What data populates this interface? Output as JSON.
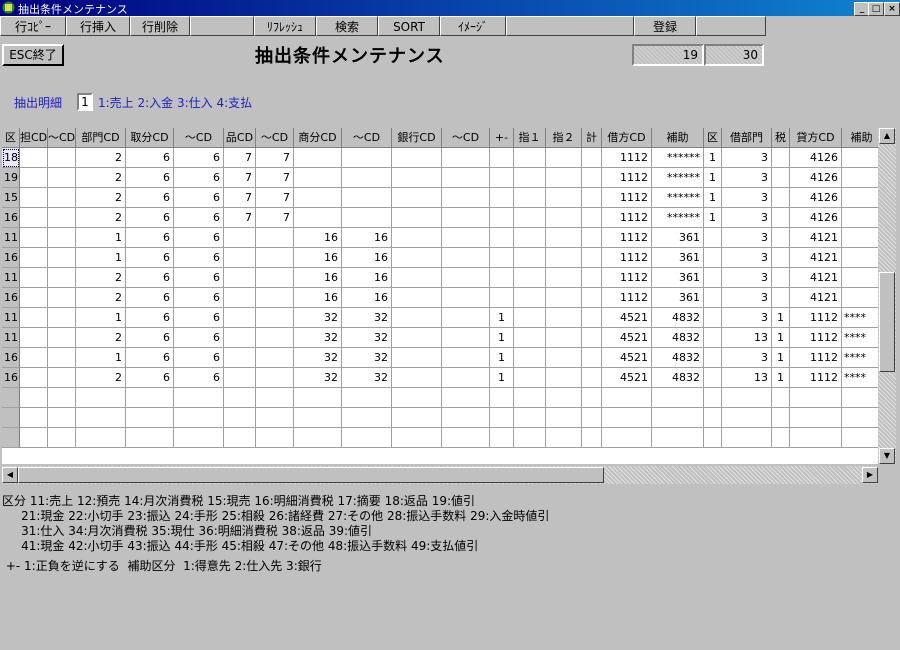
{
  "window": {
    "title": "抽出条件メンテナンス",
    "min": "_",
    "max": "□",
    "close": "×"
  },
  "toolbar": {
    "buttons": [
      "行ｺﾋﾟｰ",
      "行挿入",
      "行削除",
      "",
      "ﾘﾌﾚｯｼｭ",
      "検索",
      "SORT",
      "ｲﾒｰｼﾞ",
      "",
      "登録",
      ""
    ]
  },
  "esc_label": "ESC終了",
  "page_title": "抽出条件メンテナンス",
  "pager": {
    "current": "19",
    "total": "30"
  },
  "filter": {
    "label": "抽出明細",
    "value": "1",
    "hint": "1:売上 2:入金 3:仕入 4:支払"
  },
  "table": {
    "headers": [
      "区",
      "担CD",
      "〜CD",
      "部門CD",
      "取分CD",
      "〜CD",
      "品CD",
      "〜CD",
      "商分CD",
      "〜CD",
      "銀行CD",
      "〜CD",
      "+-",
      "指１",
      "指２",
      "計",
      "借方CD",
      "補助",
      "区",
      "借部門",
      "税",
      "貸方CD",
      "補助"
    ],
    "rows": [
      [
        "18",
        "",
        "",
        "2",
        "6",
        "6",
        "7",
        "7",
        "",
        "",
        "",
        "",
        "",
        "",
        "",
        "",
        "1112",
        "******",
        "1",
        "3",
        "",
        "4126",
        ""
      ],
      [
        "19",
        "",
        "",
        "2",
        "6",
        "6",
        "7",
        "7",
        "",
        "",
        "",
        "",
        "",
        "",
        "",
        "",
        "1112",
        "******",
        "1",
        "3",
        "",
        "4126",
        ""
      ],
      [
        "15",
        "",
        "",
        "2",
        "6",
        "6",
        "7",
        "7",
        "",
        "",
        "",
        "",
        "",
        "",
        "",
        "",
        "1112",
        "******",
        "1",
        "3",
        "",
        "4126",
        ""
      ],
      [
        "16",
        "",
        "",
        "2",
        "6",
        "6",
        "7",
        "7",
        "",
        "",
        "",
        "",
        "",
        "",
        "",
        "",
        "1112",
        "******",
        "1",
        "3",
        "",
        "4126",
        ""
      ],
      [
        "11",
        "",
        "",
        "1",
        "6",
        "6",
        "",
        "",
        "16",
        "16",
        "",
        "",
        "",
        "",
        "",
        "",
        "1112",
        "361",
        "",
        "3",
        "",
        "4121",
        ""
      ],
      [
        "16",
        "",
        "",
        "1",
        "6",
        "6",
        "",
        "",
        "16",
        "16",
        "",
        "",
        "",
        "",
        "",
        "",
        "1112",
        "361",
        "",
        "3",
        "",
        "4121",
        ""
      ],
      [
        "11",
        "",
        "",
        "2",
        "6",
        "6",
        "",
        "",
        "16",
        "16",
        "",
        "",
        "",
        "",
        "",
        "",
        "1112",
        "361",
        "",
        "3",
        "",
        "4121",
        ""
      ],
      [
        "16",
        "",
        "",
        "2",
        "6",
        "6",
        "",
        "",
        "16",
        "16",
        "",
        "",
        "",
        "",
        "",
        "",
        "1112",
        "361",
        "",
        "3",
        "",
        "4121",
        ""
      ],
      [
        "11",
        "",
        "",
        "1",
        "6",
        "6",
        "",
        "",
        "32",
        "32",
        "",
        "",
        "1",
        "",
        "",
        "",
        "4521",
        "4832",
        "",
        "3",
        "1",
        "1112",
        "****"
      ],
      [
        "11",
        "",
        "",
        "2",
        "6",
        "6",
        "",
        "",
        "32",
        "32",
        "",
        "",
        "1",
        "",
        "",
        "",
        "4521",
        "4832",
        "",
        "13",
        "1",
        "1112",
        "****"
      ],
      [
        "16",
        "",
        "",
        "1",
        "6",
        "6",
        "",
        "",
        "32",
        "32",
        "",
        "",
        "1",
        "",
        "",
        "",
        "4521",
        "4832",
        "",
        "3",
        "1",
        "1112",
        "****"
      ],
      [
        "16",
        "",
        "",
        "2",
        "6",
        "6",
        "",
        "",
        "32",
        "32",
        "",
        "",
        "1",
        "",
        "",
        "",
        "4521",
        "4832",
        "",
        "13",
        "1",
        "1112",
        "****"
      ]
    ]
  },
  "legend": [
    "区分 11:売上 12:預売 14:月次消費税 15:現売 16:明細消費税 17:摘要 18:返品 19:値引",
    "     21:現金 22:小切手 23:振込 24:手形 25:相殺 26:諸経費 27:その他 28:振込手数料 29:入金時値引",
    "     31:仕入 34:月次消費税 35:現仕 36:明細消費税 38:返品 39:値引",
    "     41:現金 42:小切手 43:振込 44:手形 45:相殺 47:その他 48:振込手数料 49:支払値引",
    " +- 1:正負を逆にする  補助区分  1:得意先 2:仕入先 3:銀行"
  ]
}
